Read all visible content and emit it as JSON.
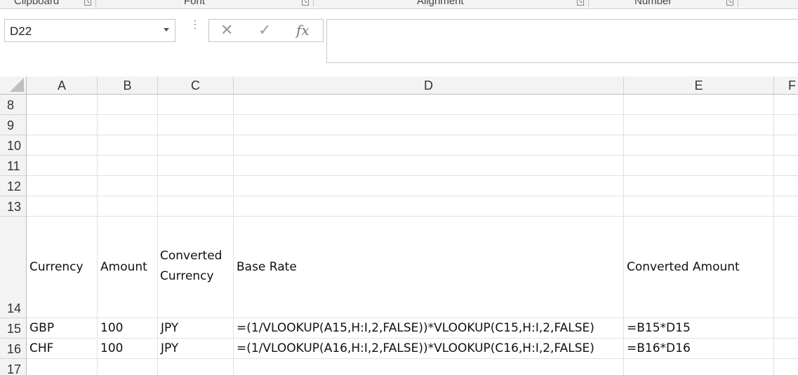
{
  "ribbon": {
    "groups": [
      "Clipboard",
      "Font",
      "Alignment",
      "Number"
    ]
  },
  "formula_bar": {
    "name_box": "D22",
    "cancel_glyph": "✕",
    "enter_glyph": "✓",
    "fx_glyph": "fx",
    "formula": ""
  },
  "columns": [
    "A",
    "B",
    "C",
    "D",
    "E",
    "F"
  ],
  "rows": [
    {
      "number": "8",
      "cells": [
        "",
        "",
        "",
        "",
        ""
      ]
    },
    {
      "number": "9",
      "cells": [
        "",
        "",
        "",
        "",
        ""
      ]
    },
    {
      "number": "10",
      "cells": [
        "",
        "",
        "",
        "",
        ""
      ]
    },
    {
      "number": "11",
      "cells": [
        "",
        "",
        "",
        "",
        ""
      ]
    },
    {
      "number": "12",
      "cells": [
        "",
        "",
        "",
        "",
        ""
      ]
    },
    {
      "number": "13",
      "cells": [
        "",
        "",
        "",
        "",
        ""
      ]
    },
    {
      "number": "14",
      "cells": [
        "Currency",
        "Amount",
        "Converted Currency",
        "Base Rate",
        "Converted Amount"
      ]
    },
    {
      "number": "15",
      "cells": [
        "GBP",
        "100",
        "JPY",
        "=(1/VLOOKUP(A15,H:I,2,FALSE))*VLOOKUP(C15,H:I,2,FALSE)",
        "=B15*D15"
      ]
    },
    {
      "number": "16",
      "cells": [
        "CHF",
        "100",
        "JPY",
        "=(1/VLOOKUP(A16,H:I,2,FALSE))*VLOOKUP(C16,H:I,2,FALSE)",
        "=B16*D16"
      ]
    },
    {
      "number": "17",
      "cells": [
        "",
        "",
        "",
        "",
        ""
      ]
    }
  ],
  "icons": {
    "cancel": "close-icon",
    "enter": "check-icon",
    "function": "fx-icon",
    "launcher": "dialog-launcher-icon",
    "dropdown": "chevron-down-icon"
  }
}
